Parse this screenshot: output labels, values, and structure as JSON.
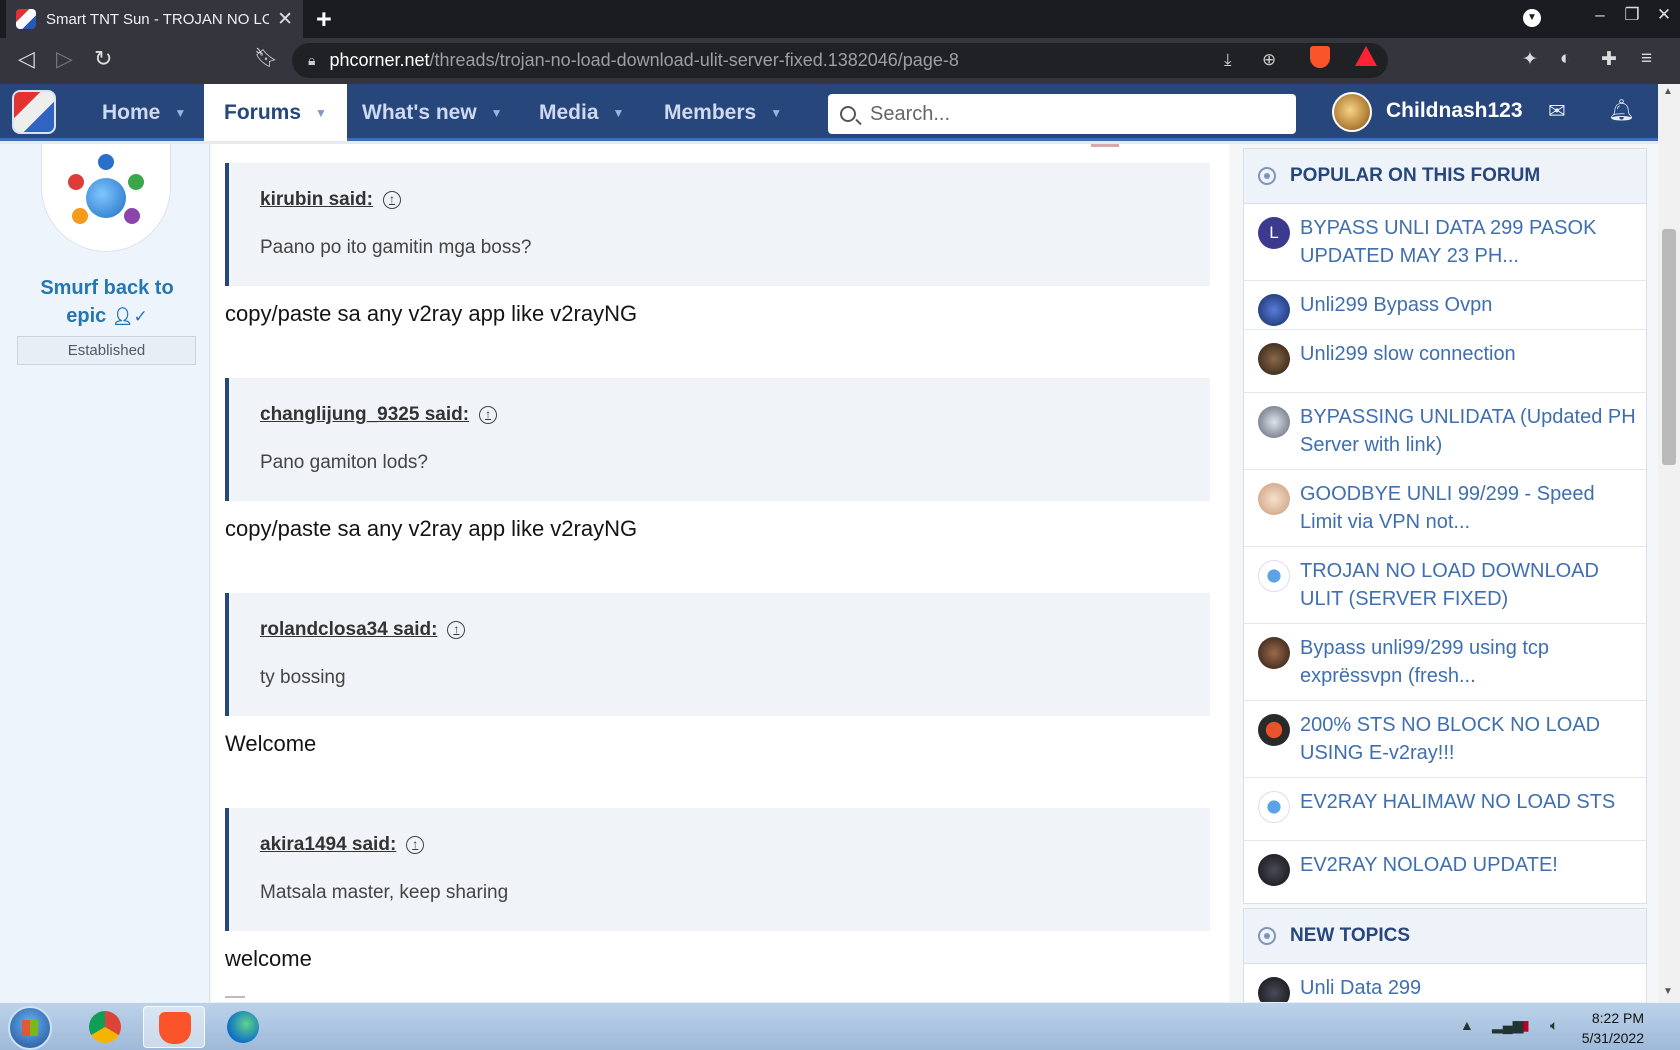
{
  "browser": {
    "tab_title": "Smart TNT Sun - TROJAN NO LOA",
    "tab_close": "✕",
    "new_tab": "+",
    "url_host": "phcorner.net",
    "url_path": "/threads/trojan-no-load-download-ulit-server-fixed.1382046/page-8",
    "shields_count": "1"
  },
  "site": {
    "nav": [
      "Home",
      "Forums",
      "What's new",
      "Media",
      "Members"
    ],
    "search_placeholder": "Search...",
    "username": "Childnash123"
  },
  "user_pane": {
    "name": "Smurf back to epic",
    "badge": "Established"
  },
  "posts": [
    {
      "quote_author": "kirubin said:",
      "quote_text": "Paano po ito gamitin mga boss?",
      "reply": "copy/paste sa any v2ray app like v2rayNG"
    },
    {
      "quote_author": "changlijung_9325 said:",
      "quote_text": "Pano gamiton lods?",
      "reply": "copy/paste sa any v2ray app like v2rayNG"
    },
    {
      "quote_author": "rolandclosa34 said:",
      "quote_text": "ty bossing",
      "reply": "Welcome"
    },
    {
      "quote_author": "akira1494 said:",
      "quote_text": "Matsala master, keep sharing",
      "reply": "welcome"
    }
  ],
  "sidebar": {
    "popular_title": "POPULAR ON THIS FORUM",
    "popular_items": [
      "BYPASS UNLI DATA 299 PASOK UPDATED MAY 23 PH...",
      "Unli299 Bypass Ovpn",
      "Unli299 slow connection",
      "BYPASSING UNLIDATA (Updated PH Server with link)",
      "GOODBYE UNLI 99/299 - Speed Limit via VPN not...",
      "TROJAN NO LOAD DOWNLOAD ULIT (SERVER FIXED)",
      "Bypass unli99/299 using tcp exprëssvpn (fresh...",
      "200% STS NO BLOCK NO LOAD USING E-v2ray!!!",
      "EV2RAY HALIMAW NO LOAD STS",
      "EV2RAY NOLOAD UPDATE!"
    ],
    "first_avatar_letter": "L",
    "new_topics_title": "NEW TOPICS",
    "new_topics_items": [
      "Unli Data 299"
    ]
  },
  "taskbar": {
    "time": "8:22 PM",
    "date": "5/31/2022"
  },
  "colors": {
    "site_header": "#26467c",
    "link": "#3f6fb0",
    "accent": "#2577b1"
  }
}
